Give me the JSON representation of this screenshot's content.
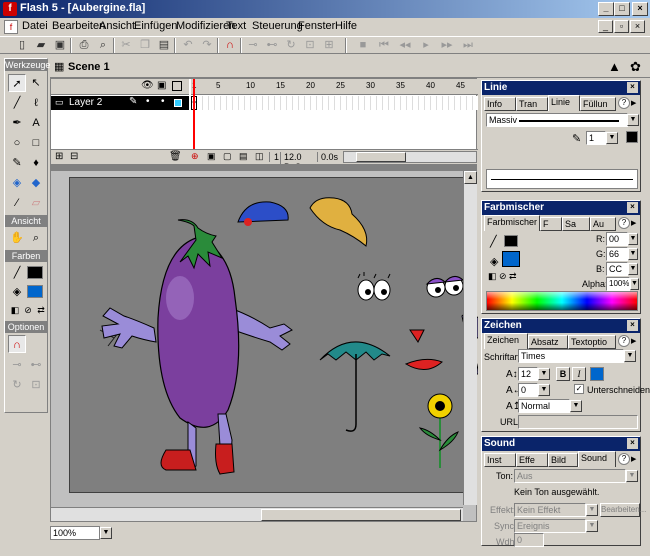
{
  "window": {
    "title": "Flash 5 - [Aubergine.fla]",
    "app_icon": "flash-icon",
    "buttons": [
      "_",
      "□",
      "×"
    ]
  },
  "menu": [
    "Datei",
    "Bearbeiten",
    "Ansicht",
    "Einfügen",
    "Modifizieren",
    "Text",
    "Steuerung",
    "Fenster",
    "Hilfe"
  ],
  "tools": {
    "header": "Werkzeuge",
    "view_header": "Ansicht",
    "colors_header": "Farben",
    "options_header": "Optionen"
  },
  "scene": {
    "name": "Scene 1"
  },
  "timeline": {
    "layer_name": "Layer 2",
    "ruler_numbers": [
      "1",
      "5",
      "10",
      "15",
      "20",
      "25",
      "30",
      "35",
      "40",
      "45"
    ],
    "current_frame": "1",
    "frame_rate": "12.0 BpS",
    "time": "0.0s"
  },
  "zoom": "100%",
  "panels": {
    "linie": {
      "title": "Linie",
      "tabs": [
        "Info",
        "Tran",
        "Linie",
        "Füllun"
      ],
      "style_value": "Massiv",
      "width_value": "1"
    },
    "farbmischer": {
      "title": "Farbmischer",
      "tabs": [
        "Farbmischer",
        "F",
        "Sa",
        "Au"
      ],
      "r_label": "R:",
      "r_value": "00",
      "g_label": "G:",
      "g_value": "66",
      "b_label": "B:",
      "b_value": "CC",
      "alpha_label": "Alpha:",
      "alpha_value": "100%"
    },
    "zeichen": {
      "title": "Zeichen",
      "tabs": [
        "Zeichen",
        "Absatz",
        "Textoptio"
      ],
      "font_label": "Schriftart:",
      "font_value": "Times",
      "size_value": "12",
      "bold_label": "B",
      "italic_label": "I",
      "tracking_value": "0",
      "kerning_label": "Unterschneiden",
      "position_value": "Normal",
      "url_label": "URL:"
    },
    "sound": {
      "title": "Sound",
      "tabs": [
        "Inst",
        "Effe",
        "Bild",
        "Sound"
      ],
      "ton_label": "Ton:",
      "ton_value": "Aus",
      "no_sound_text": "Kein Ton ausgewählt.",
      "effekt_label": "Effekt:",
      "effekt_value": "Kein Effekt",
      "edit_button": "Bearbeiten...",
      "sync_label": "Sync:",
      "sync_value": "Ereignis",
      "loop_label": "Wdh:",
      "loop_value": "0"
    }
  },
  "colors": {
    "titlebar_start": "#0a246a",
    "titlebar_end": "#a6caf0",
    "fill_color": "#0066CC",
    "stage_bg": "#7f7f7f",
    "aubergine": "#7b3f9e"
  }
}
